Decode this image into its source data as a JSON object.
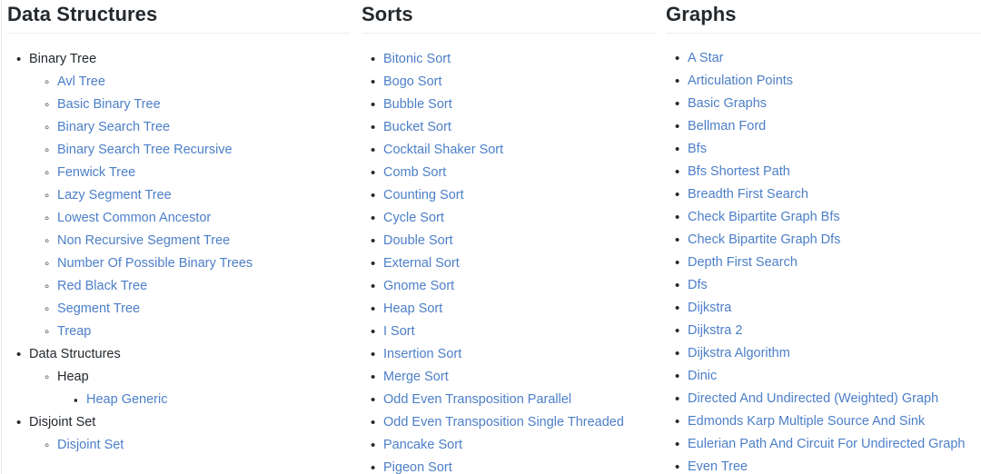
{
  "columns": [
    {
      "id": "data-structures",
      "title": "Data Structures",
      "groups": [
        {
          "label": "Binary Tree",
          "is_link": false,
          "children": [
            {
              "label": "Avl Tree",
              "is_link": true
            },
            {
              "label": "Basic Binary Tree",
              "is_link": true
            },
            {
              "label": "Binary Search Tree",
              "is_link": true
            },
            {
              "label": "Binary Search Tree Recursive",
              "is_link": true
            },
            {
              "label": "Fenwick Tree",
              "is_link": true
            },
            {
              "label": "Lazy Segment Tree",
              "is_link": true
            },
            {
              "label": "Lowest Common Ancestor",
              "is_link": true
            },
            {
              "label": "Non Recursive Segment Tree",
              "is_link": true
            },
            {
              "label": "Number Of Possible Binary Trees",
              "is_link": true
            },
            {
              "label": "Red Black Tree",
              "is_link": true
            },
            {
              "label": "Segment Tree",
              "is_link": true
            },
            {
              "label": "Treap",
              "is_link": true
            }
          ]
        },
        {
          "label": "Data Structures",
          "is_link": false,
          "children": [
            {
              "label": "Heap",
              "is_link": false,
              "children": [
                {
                  "label": "Heap Generic",
                  "is_link": true
                }
              ]
            }
          ]
        },
        {
          "label": "Disjoint Set",
          "is_link": false,
          "children": [
            {
              "label": "Disjoint Set",
              "is_link": true
            }
          ]
        }
      ]
    },
    {
      "id": "sorts",
      "title": "Sorts",
      "items": [
        {
          "label": "Bitonic Sort",
          "is_link": true
        },
        {
          "label": "Bogo Sort",
          "is_link": true
        },
        {
          "label": "Bubble Sort",
          "is_link": true
        },
        {
          "label": "Bucket Sort",
          "is_link": true
        },
        {
          "label": "Cocktail Shaker Sort",
          "is_link": true
        },
        {
          "label": "Comb Sort",
          "is_link": true
        },
        {
          "label": "Counting Sort",
          "is_link": true
        },
        {
          "label": "Cycle Sort",
          "is_link": true
        },
        {
          "label": "Double Sort",
          "is_link": true
        },
        {
          "label": "External Sort",
          "is_link": true
        },
        {
          "label": "Gnome Sort",
          "is_link": true
        },
        {
          "label": "Heap Sort",
          "is_link": true
        },
        {
          "label": "I Sort",
          "is_link": true
        },
        {
          "label": "Insertion Sort",
          "is_link": true
        },
        {
          "label": "Merge Sort",
          "is_link": true
        },
        {
          "label": "Odd Even Transposition Parallel",
          "is_link": true
        },
        {
          "label": "Odd Even Transposition Single Threaded",
          "is_link": true
        },
        {
          "label": "Pancake Sort",
          "is_link": true
        },
        {
          "label": "Pigeon Sort",
          "is_link": true
        }
      ]
    },
    {
      "id": "graphs",
      "title": "Graphs",
      "items": [
        {
          "label": "A Star",
          "is_link": true
        },
        {
          "label": "Articulation Points",
          "is_link": true
        },
        {
          "label": "Basic Graphs",
          "is_link": true
        },
        {
          "label": "Bellman Ford",
          "is_link": true
        },
        {
          "label": "Bfs",
          "is_link": true
        },
        {
          "label": "Bfs Shortest Path",
          "is_link": true
        },
        {
          "label": "Breadth First Search",
          "is_link": true
        },
        {
          "label": "Check Bipartite Graph Bfs",
          "is_link": true
        },
        {
          "label": "Check Bipartite Graph Dfs",
          "is_link": true
        },
        {
          "label": "Depth First Search",
          "is_link": true
        },
        {
          "label": "Dfs",
          "is_link": true
        },
        {
          "label": "Dijkstra",
          "is_link": true
        },
        {
          "label": "Dijkstra 2",
          "is_link": true
        },
        {
          "label": "Dijkstra Algorithm",
          "is_link": true
        },
        {
          "label": "Dinic",
          "is_link": true
        },
        {
          "label": "Directed And Undirected (Weighted) Graph",
          "is_link": true
        },
        {
          "label": "Edmonds Karp Multiple Source And Sink",
          "is_link": true
        },
        {
          "label": "Eulerian Path And Circuit For Undirected Graph",
          "is_link": true
        },
        {
          "label": "Even Tree",
          "is_link": true
        }
      ]
    }
  ],
  "colors": {
    "link": "#4c7fc8",
    "text": "#24292e",
    "rule": "#eaecef",
    "background": "#ffffff"
  }
}
